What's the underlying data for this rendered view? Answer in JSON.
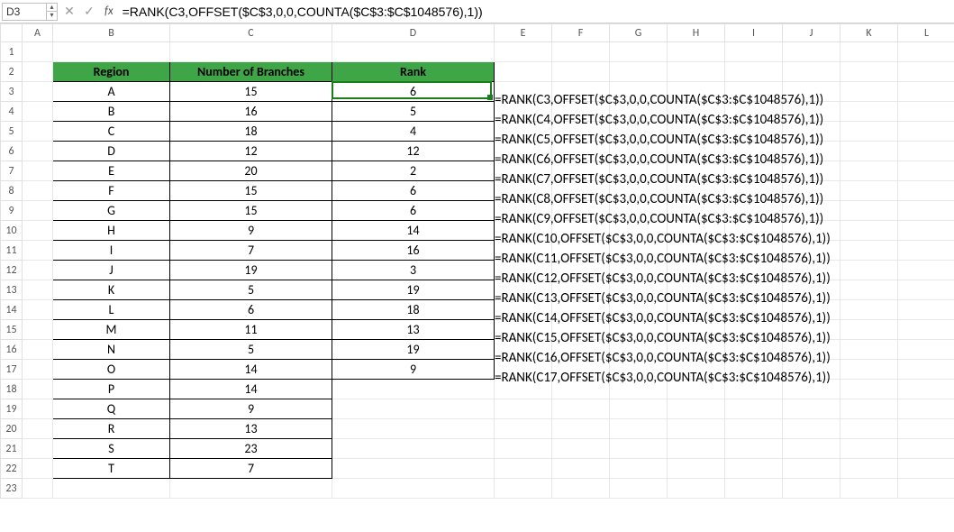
{
  "name_box": "D3",
  "formula_bar": "=RANK(C3,OFFSET($C$3,0,0,COUNTA($C$3:$C$1048576),1))",
  "fx_label": "fx",
  "columns": [
    "A",
    "B",
    "C",
    "D",
    "E",
    "F",
    "G",
    "H",
    "I",
    "J",
    "K",
    "L"
  ],
  "row_numbers": [
    1,
    2,
    3,
    4,
    5,
    6,
    7,
    8,
    9,
    10,
    11,
    12,
    13,
    14,
    15,
    16,
    17,
    18,
    19,
    20,
    21,
    22,
    23
  ],
  "active_cell": "D3",
  "headers": {
    "region": "Region",
    "branches": "Number of Branches",
    "rank": "Rank"
  },
  "rows": [
    {
      "region": "A",
      "branches": 15,
      "rank": 6,
      "formula": "=RANK(C3,OFFSET($C$3,0,0,COUNTA($C$3:$C$1048576),1))"
    },
    {
      "region": "B",
      "branches": 16,
      "rank": 5,
      "formula": "=RANK(C4,OFFSET($C$3,0,0,COUNTA($C$3:$C$1048576),1))"
    },
    {
      "region": "C",
      "branches": 18,
      "rank": 4,
      "formula": "=RANK(C5,OFFSET($C$3,0,0,COUNTA($C$3:$C$1048576),1))"
    },
    {
      "region": "D",
      "branches": 12,
      "rank": 12,
      "formula": "=RANK(C6,OFFSET($C$3,0,0,COUNTA($C$3:$C$1048576),1))"
    },
    {
      "region": "E",
      "branches": 20,
      "rank": 2,
      "formula": "=RANK(C7,OFFSET($C$3,0,0,COUNTA($C$3:$C$1048576),1))"
    },
    {
      "region": "F",
      "branches": 15,
      "rank": 6,
      "formula": "=RANK(C8,OFFSET($C$3,0,0,COUNTA($C$3:$C$1048576),1))"
    },
    {
      "region": "G",
      "branches": 15,
      "rank": 6,
      "formula": "=RANK(C9,OFFSET($C$3,0,0,COUNTA($C$3:$C$1048576),1))"
    },
    {
      "region": "H",
      "branches": 9,
      "rank": 14,
      "formula": "=RANK(C10,OFFSET($C$3,0,0,COUNTA($C$3:$C$1048576),1))"
    },
    {
      "region": "I",
      "branches": 7,
      "rank": 16,
      "formula": "=RANK(C11,OFFSET($C$3,0,0,COUNTA($C$3:$C$1048576),1))"
    },
    {
      "region": "J",
      "branches": 19,
      "rank": 3,
      "formula": "=RANK(C12,OFFSET($C$3,0,0,COUNTA($C$3:$C$1048576),1))"
    },
    {
      "region": "K",
      "branches": 5,
      "rank": 19,
      "formula": "=RANK(C13,OFFSET($C$3,0,0,COUNTA($C$3:$C$1048576),1))"
    },
    {
      "region": "L",
      "branches": 6,
      "rank": 18,
      "formula": "=RANK(C14,OFFSET($C$3,0,0,COUNTA($C$3:$C$1048576),1))"
    },
    {
      "region": "M",
      "branches": 11,
      "rank": 13,
      "formula": "=RANK(C15,OFFSET($C$3,0,0,COUNTA($C$3:$C$1048576),1))"
    },
    {
      "region": "N",
      "branches": 5,
      "rank": 19,
      "formula": "=RANK(C16,OFFSET($C$3,0,0,COUNTA($C$3:$C$1048576),1))"
    },
    {
      "region": "O",
      "branches": 14,
      "rank": 9,
      "formula": "=RANK(C17,OFFSET($C$3,0,0,COUNTA($C$3:$C$1048576),1))"
    },
    {
      "region": "P",
      "branches": 14,
      "rank": null,
      "formula": null
    },
    {
      "region": "Q",
      "branches": 9,
      "rank": null,
      "formula": null
    },
    {
      "region": "R",
      "branches": 13,
      "rank": null,
      "formula": null
    },
    {
      "region": "S",
      "branches": 23,
      "rank": null,
      "formula": null
    },
    {
      "region": "T",
      "branches": 7,
      "rank": null,
      "formula": null
    }
  ],
  "colors": {
    "header_bg": "#3FA648",
    "header_fg": "#FFFFFF",
    "selection": "#1a7f1a"
  }
}
